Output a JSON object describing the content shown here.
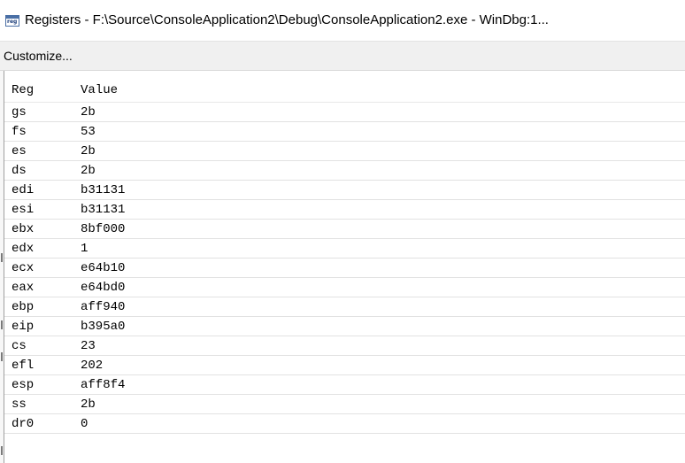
{
  "window": {
    "title": "Registers - F:\\Source\\ConsoleApplication2\\Debug\\ConsoleApplication2.exe - WinDbg:1...",
    "icon": "registers-icon",
    "icon_text": "reg"
  },
  "toolbar": {
    "customize_label": "Customize..."
  },
  "table": {
    "columns": [
      "Reg",
      "Value"
    ],
    "rows": [
      {
        "reg": "gs",
        "value": "2b"
      },
      {
        "reg": "fs",
        "value": "53"
      },
      {
        "reg": "es",
        "value": "2b"
      },
      {
        "reg": "ds",
        "value": "2b"
      },
      {
        "reg": "edi",
        "value": "b31131"
      },
      {
        "reg": "esi",
        "value": "b31131"
      },
      {
        "reg": "ebx",
        "value": "8bf000"
      },
      {
        "reg": "edx",
        "value": "1"
      },
      {
        "reg": "ecx",
        "value": "e64b10"
      },
      {
        "reg": "eax",
        "value": "e64bd0"
      },
      {
        "reg": "ebp",
        "value": "aff940"
      },
      {
        "reg": "eip",
        "value": "b395a0"
      },
      {
        "reg": "cs",
        "value": "23"
      },
      {
        "reg": "efl",
        "value": "202"
      },
      {
        "reg": "esp",
        "value": "aff8f4"
      },
      {
        "reg": "ss",
        "value": "2b"
      },
      {
        "reg": "dr0",
        "value": "0"
      }
    ]
  }
}
